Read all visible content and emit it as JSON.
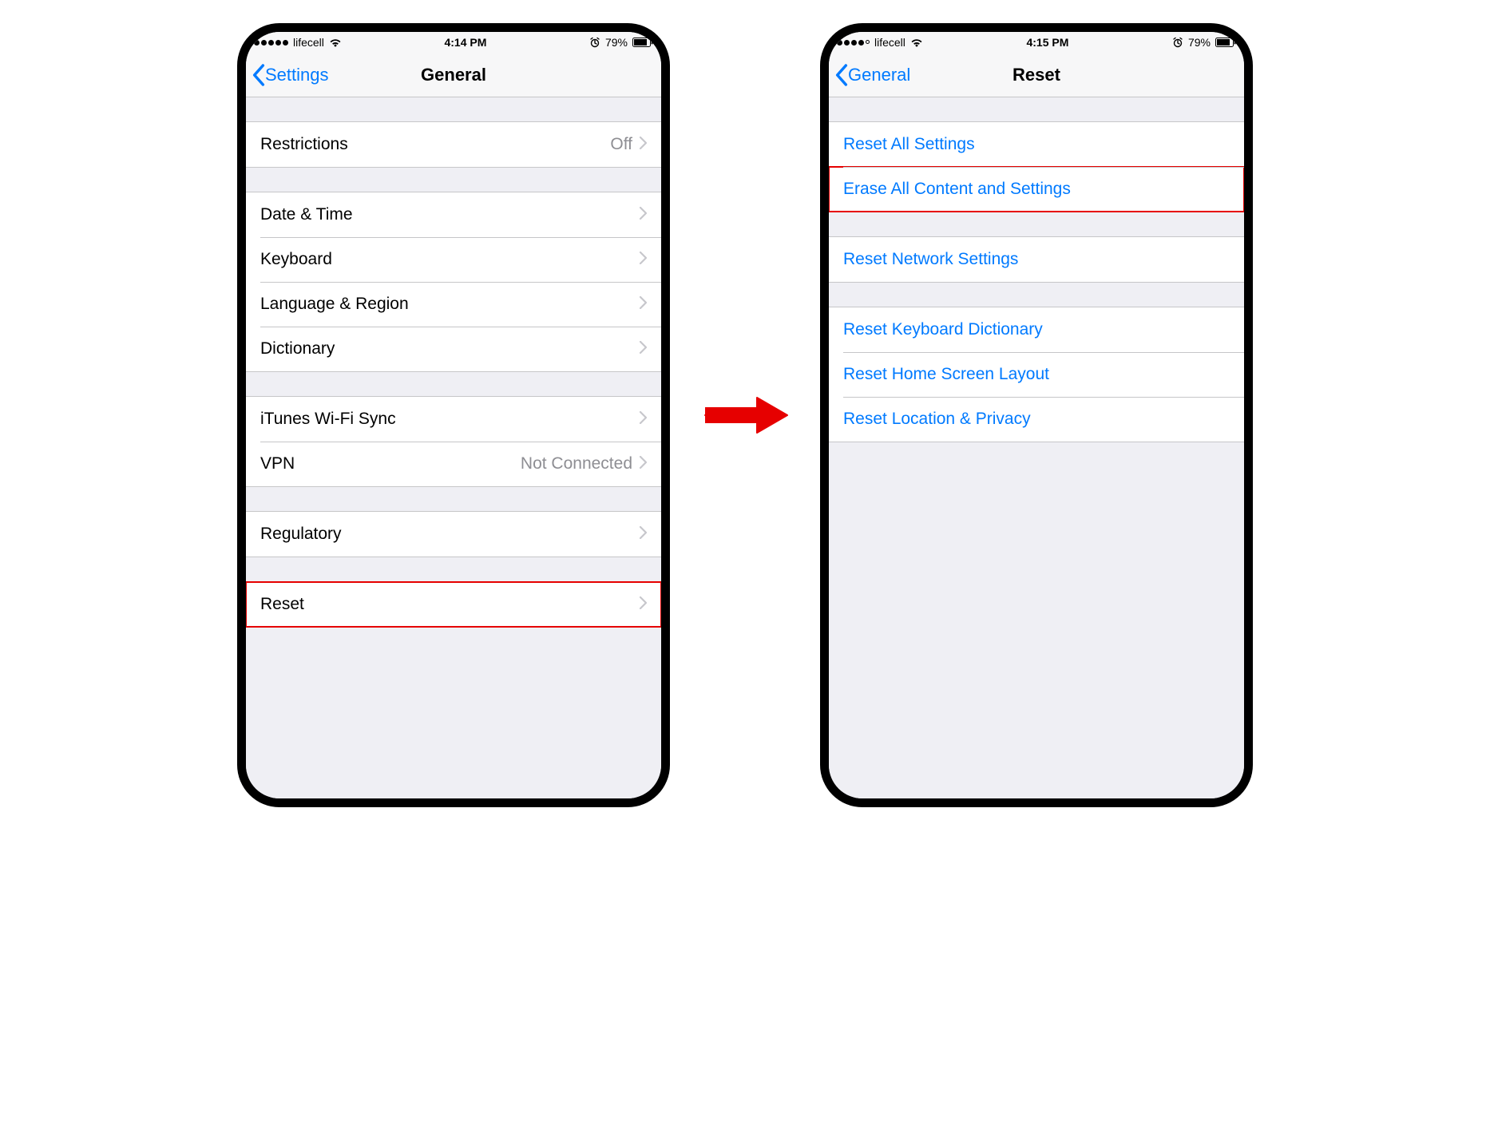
{
  "left": {
    "status": {
      "carrier": "lifecell",
      "time": "4:14 PM",
      "battery": "79%"
    },
    "nav": {
      "back": "Settings",
      "title": "General"
    },
    "groups": [
      [
        {
          "label": "Restrictions",
          "value": "Off",
          "chev": true
        }
      ],
      [
        {
          "label": "Date & Time",
          "chev": true
        },
        {
          "label": "Keyboard",
          "chev": true
        },
        {
          "label": "Language & Region",
          "chev": true
        },
        {
          "label": "Dictionary",
          "chev": true
        }
      ],
      [
        {
          "label": "iTunes Wi-Fi Sync",
          "chev": true
        },
        {
          "label": "VPN",
          "value": "Not Connected",
          "chev": true
        }
      ],
      [
        {
          "label": "Regulatory",
          "chev": true
        }
      ],
      [
        {
          "label": "Reset",
          "chev": true,
          "highlight": true
        }
      ]
    ]
  },
  "right": {
    "status": {
      "carrier": "lifecell",
      "time": "4:15 PM",
      "battery": "79%"
    },
    "nav": {
      "back": "General",
      "title": "Reset"
    },
    "groups": [
      [
        {
          "label": "Reset All Settings",
          "link": true
        },
        {
          "label": "Erase All Content and Settings",
          "link": true,
          "highlight": true
        }
      ],
      [
        {
          "label": "Reset Network Settings",
          "link": true
        }
      ],
      [
        {
          "label": "Reset Keyboard Dictionary",
          "link": true
        },
        {
          "label": "Reset Home Screen Layout",
          "link": true
        },
        {
          "label": "Reset Location & Privacy",
          "link": true
        }
      ]
    ]
  }
}
